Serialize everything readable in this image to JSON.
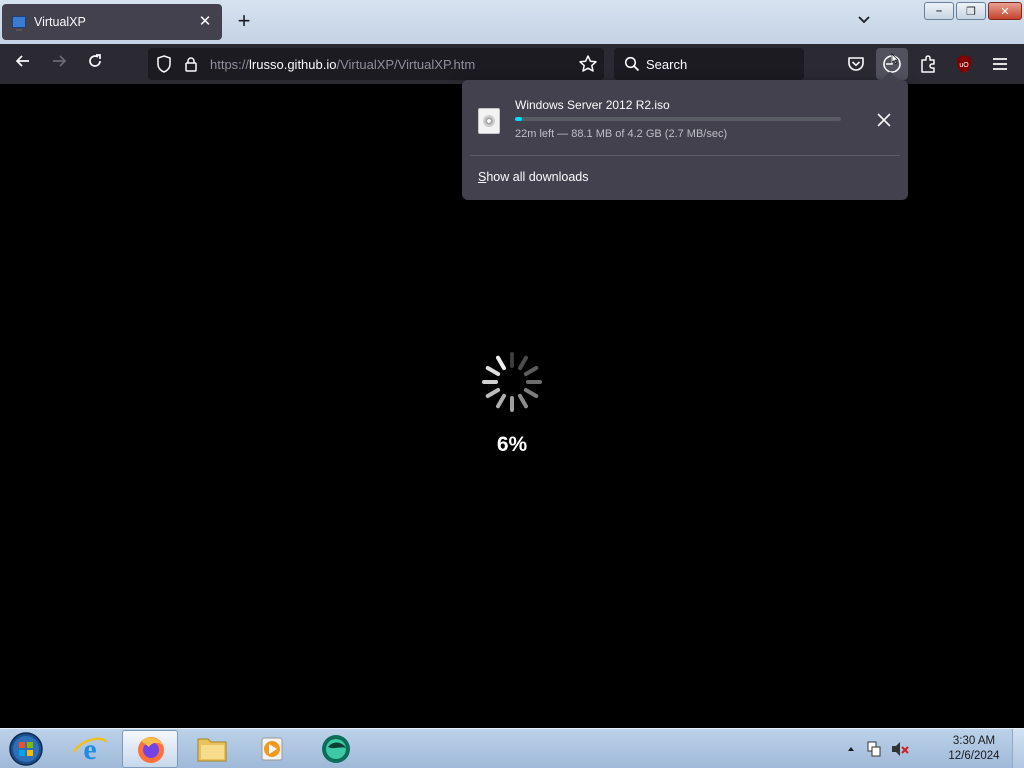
{
  "browser": {
    "tab": {
      "title": "VirtualXP",
      "close_glyph": "✕"
    },
    "new_tab_glyph": "+",
    "list_tabs_glyph": "⌄",
    "window_buttons": {
      "minimize": "–",
      "restore": "❐",
      "close": "✕"
    },
    "nav": {
      "back": "←",
      "forward": "→",
      "reload": "↻"
    },
    "url": {
      "scheme": "https://",
      "host": "lrusso.github.io",
      "path": "/VirtualXP/VirtualXP.htm"
    },
    "search": {
      "placeholder": "Search"
    }
  },
  "page": {
    "progress_text": "6%"
  },
  "downloads": {
    "file_name": "Windows Server 2012 R2.iso",
    "status": "22m left — 88.1 MB of 4.2 GB (2.7 MB/sec)",
    "progress_percent": 2,
    "show_all_prefix": "S",
    "show_all_rest": "how all downloads"
  },
  "taskbar": {
    "clock_time": "3:30 AM",
    "clock_date": "12/6/2024",
    "tray_expand_glyph": "▲"
  },
  "colors": {
    "browser_bg": "#1c1b22",
    "toolbar_bg": "#2b2a33",
    "panel_bg": "#42414d",
    "download_accent": "#00ddff",
    "page_bg": "#000000"
  }
}
